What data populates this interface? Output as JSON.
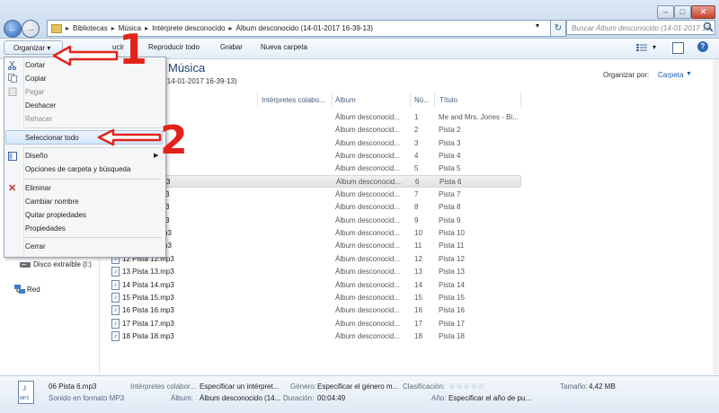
{
  "address": {
    "crumbs": [
      "Bibliotecas",
      "Música",
      "Intérprete desconocido",
      "Álbum desconocido (14-01-2017 16-39-13)"
    ],
    "search_placeholder": "Buscar Álbum desconocido (14-01-2017 16-39-13)"
  },
  "toolbar": {
    "organizar": "Organizar",
    "play_partial": "ucir",
    "play_all": "Reproducir todo",
    "burn": "Grabar",
    "new_folder": "Nueva carpeta"
  },
  "library": {
    "title": "Música",
    "subtitle": "do (14-01-2017 16-39-13)",
    "arrange_label": "Organizar por:",
    "arrange_value": "Carpeta"
  },
  "columns": {
    "artists": "Intérpretes colabo...",
    "album": "Álbum",
    "num": "Nú...",
    "title": "Título"
  },
  "rows": [
    {
      "name": "",
      "album": "Álbum desconocid...",
      "num": "1",
      "title": "Me and Mrs. Jones - Bi..."
    },
    {
      "name": "",
      "album": "Álbum desconocid...",
      "num": "2",
      "title": "Pista 2"
    },
    {
      "name": "",
      "album": "Álbum desconocid...",
      "num": "3",
      "title": "Pista 3"
    },
    {
      "name": "",
      "album": "Álbum desconocid...",
      "num": "4",
      "title": "Pista 4"
    },
    {
      "name": "",
      "album": "Álbum desconocid...",
      "num": "5",
      "title": "Pista 5"
    },
    {
      "name": "3",
      "album": "Álbum desconocid...",
      "num": "6",
      "title": "Pista 6"
    },
    {
      "name": "3",
      "album": "Álbum desconocid...",
      "num": "7",
      "title": "Pista 7"
    },
    {
      "name": "3",
      "album": "Álbum desconocid...",
      "num": "8",
      "title": "Pista 8"
    },
    {
      "name": "3",
      "album": "Álbum desconocid...",
      "num": "9",
      "title": "Pista 9"
    },
    {
      "name": "p3",
      "album": "Álbum desconocid...",
      "num": "10",
      "title": "Pista 10"
    },
    {
      "name": "p3",
      "album": "Álbum desconocid...",
      "num": "11",
      "title": "Pista 11"
    },
    {
      "name": "12 Pista 12.mp3",
      "album": "Álbum desconocid...",
      "num": "12",
      "title": "Pista 12"
    },
    {
      "name": "13 Pista 13.mp3",
      "album": "Álbum desconocid...",
      "num": "13",
      "title": "Pista 13"
    },
    {
      "name": "14 Pista 14.mp3",
      "album": "Álbum desconocid...",
      "num": "14",
      "title": "Pista 14"
    },
    {
      "name": "15 Pista 15.mp3",
      "album": "Álbum desconocid...",
      "num": "15",
      "title": "Pista 15"
    },
    {
      "name": "16 Pista 16.mp3",
      "album": "Álbum desconocid...",
      "num": "16",
      "title": "Pista 16"
    },
    {
      "name": "17 Pista 17.mp3",
      "album": "Álbum desconocid...",
      "num": "17",
      "title": "Pista 17"
    },
    {
      "name": "18 Pista 18.mp3",
      "album": "Álbum desconocid...",
      "num": "18",
      "title": "Pista 18"
    }
  ],
  "nav": {
    "removable": "Disco extraíble (I:)",
    "network": "Red"
  },
  "menu": {
    "cut": "Cortar",
    "copy": "Copiar",
    "paste": "Pegar",
    "undo": "Deshacer",
    "redo": "Rehacer",
    "select_all": "Seleccionar todo",
    "layout": "Diseño",
    "folder_options": "Opciones de carpeta y búsqueda",
    "delete": "Eliminar",
    "rename": "Cambiar nombre",
    "remove_props": "Quitar propiedades",
    "properties": "Propiedades",
    "close": "Cerrar"
  },
  "annotations": {
    "one": "1",
    "two": "2"
  },
  "details": {
    "filename": "06 Pista 6.mp3",
    "filetype": "Sonido en formato MP3",
    "artists_label": "Intérpretes colabor...",
    "artists_value": "Especificar un intérpret...",
    "album_label": "Álbum:",
    "album_value": "Álbum desconocido (14...",
    "genre_label": "Género:",
    "genre_value": "Especificar el género m...",
    "duration_label": "Duración:",
    "duration_value": "00:04:49",
    "rating_label": "Clasificación:",
    "year_label": "Año:",
    "year_value": "Especificar el año de pu...",
    "size_label": "Tamaño:",
    "size_value": "4,42 MB"
  },
  "colors": {
    "accent": "#1a5fb4",
    "annotation": "#e2231a"
  }
}
